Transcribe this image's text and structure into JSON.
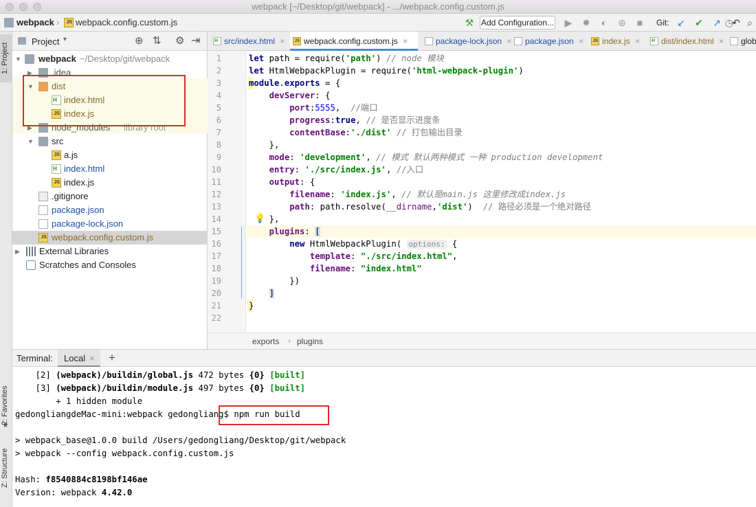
{
  "window": {
    "title": "webpack [~/Desktop/git/webpack] - .../webpack.config.custom.js"
  },
  "navbar": {
    "project_name": "webpack",
    "file_name": "webpack.config.custom.js",
    "add_config_label": "Add Configuration...",
    "git_label": "Git:"
  },
  "side_tabs": {
    "project": "1: Project",
    "favorites": "2: Favorites",
    "structure": "Z: Structure"
  },
  "project_panel": {
    "title": "Project",
    "root": {
      "name": "webpack",
      "path": "~/Desktop/git/webpack"
    },
    "items": [
      {
        "label": ".idea"
      },
      {
        "label": "dist"
      },
      {
        "label": "index.html"
      },
      {
        "label": "index.js"
      },
      {
        "label": "node_modules",
        "suffix": "library root"
      },
      {
        "label": "src"
      },
      {
        "label": "a.js"
      },
      {
        "label": "index.html"
      },
      {
        "label": "index.js"
      },
      {
        "label": ".gitignore"
      },
      {
        "label": "package.json"
      },
      {
        "label": "package-lock.json"
      },
      {
        "label": "webpack.config.custom.js"
      },
      {
        "label": "External Libraries"
      },
      {
        "label": "Scratches and Consoles"
      }
    ]
  },
  "tabs": [
    {
      "label": "src/index.html"
    },
    {
      "label": "webpack.config.custom.js"
    },
    {
      "label": "package-lock.json"
    },
    {
      "label": "package.json"
    },
    {
      "label": "index.js"
    },
    {
      "label": "dist/index.html"
    },
    {
      "label": "glob"
    }
  ],
  "editor": {
    "line_numbers": [
      "1",
      "2",
      "3",
      "4",
      "5",
      "6",
      "7",
      "8",
      "9",
      "10",
      "11",
      "12",
      "13",
      "14",
      "15",
      "16",
      "17",
      "18",
      "19",
      "20",
      "21",
      "22"
    ],
    "breadcrumb": [
      "exports",
      "plugins"
    ]
  },
  "terminal": {
    "title": "Terminal:",
    "tab": "Local",
    "lines": [
      {
        "idx": "[2]",
        "path": "(webpack)/buildin/global.js",
        "size": "472 bytes",
        "chunk": "{0}",
        "status": "[built]"
      },
      {
        "idx": "[3]",
        "path": "(webpack)/buildin/module.js",
        "size": "497 bytes",
        "chunk": "{0}",
        "status": "[built]"
      }
    ],
    "hidden": "+ 1 hidden module",
    "prompt": "gedongliangdeMac-mini:webpack gedongliang$",
    "command": "npm run build",
    "script_line": "> webpack_base@1.0.0 build /Users/gedongliang/Desktop/git/webpack",
    "run_line": "> webpack --config webpack.config.custom.js",
    "hash_label": "Hash:",
    "hash_value": "f8540884c8198bf146ae",
    "version_label": "Version:",
    "version_prefix": "webpack",
    "version_value": "4.42.0"
  }
}
